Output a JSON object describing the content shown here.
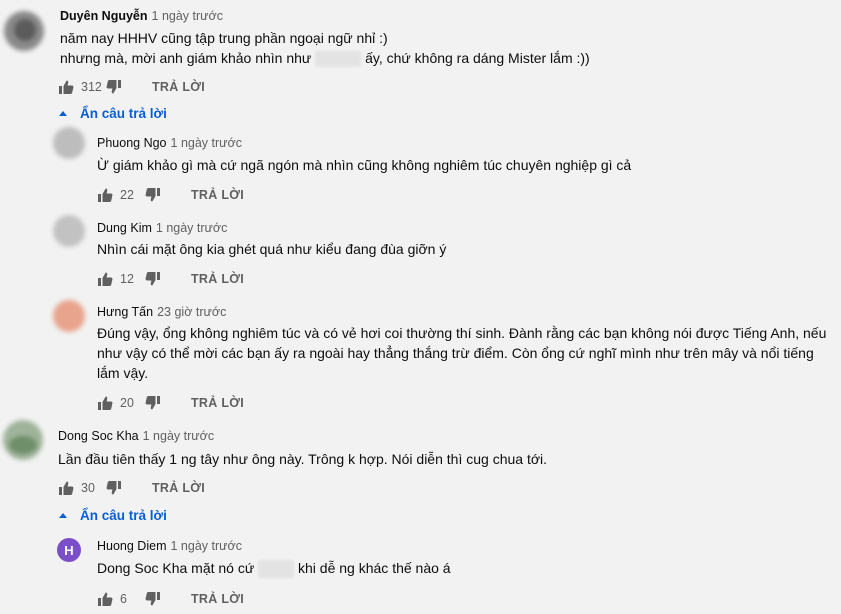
{
  "reply_label": "TRẢ LỜI",
  "hide_replies_label": "Ẩn câu trả lời",
  "comments": [
    {
      "author": "Duyên Nguyễn",
      "time": "1 ngày trước",
      "line1": "năm nay HHHV cũng tập trung phần ngoại ngữ nhỉ :)",
      "line2_before": "nhưng mà, mời anh giám khảo nhìn như",
      "line2_after": "ấy, chứ không ra dáng Mister lắm :))",
      "likes": "312"
    },
    {
      "author": "Phuong Ngo",
      "time": "1 ngày trước",
      "line1": "Ừ giám khảo gì mà cứ ngã ngón mà nhìn cũng không nghiêm túc chuyên nghiệp gì cả",
      "likes": "22"
    },
    {
      "author": "Dung Kim",
      "time": "1 ngày trước",
      "line1": "Nhìn cái mặt ông kia ghét quá như kiểu đang đùa giỡn ý",
      "likes": "12"
    },
    {
      "author": "Hưng Tấn",
      "time": "23 giờ trước",
      "line1": "Đúng vậy, ổng không nghiêm túc và có vẻ hơi coi thường thí sinh. Đành rằng các bạn không nói được Tiếng Anh, nếu",
      "line2": "như vậy có thể mời các bạn ấy ra ngoài hay thẳng thắng trừ điểm. Còn ổng cứ nghĩ mình như trên mây và nổi tiếng",
      "line3": "lắm vậy.",
      "likes": "20"
    },
    {
      "author": "Dong Soc Kha",
      "time": "1 ngày trước",
      "line1": "Lần đầu tiên thấy 1 ng tây như ông này. Trông k hợp. Nói diễn thì cug chua tới.",
      "likes": "30"
    },
    {
      "author": "Huong Diem",
      "avatar_letter": "H",
      "avatar_color": "#7a4fc7",
      "time": "1 ngày trước",
      "line1_before": "Dong Soc Kha mặt nó cứ",
      "line1_after": "khi dễ ng khác thế nào á",
      "likes": "6"
    }
  ]
}
